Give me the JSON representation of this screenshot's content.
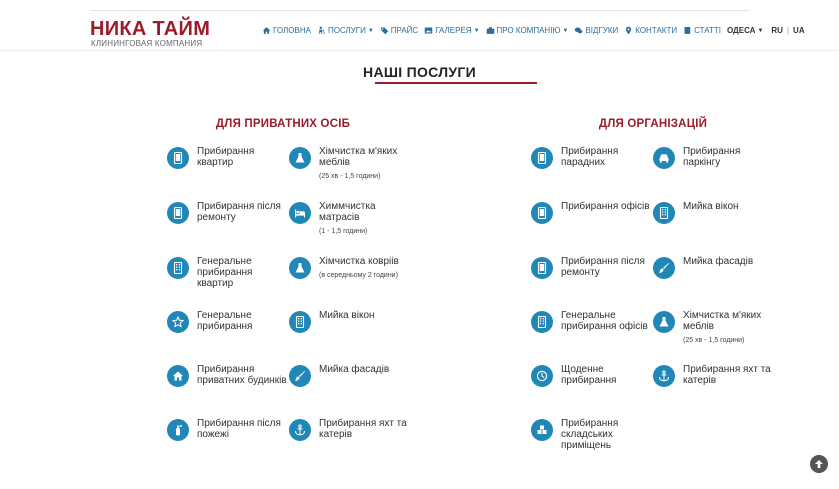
{
  "header": {
    "logo_title": "НИКА ТАЙМ",
    "logo_subtitle": "КЛИНИНГОВАЯ КОМПАНИЯ",
    "nav": [
      {
        "label": "ГОЛОВНА",
        "icon": "home-icon",
        "dropdown": false
      },
      {
        "label": "ПОСЛУГИ",
        "icon": "cleaner-icon",
        "dropdown": true
      },
      {
        "label": "ПРАЙС",
        "icon": "tags-icon",
        "dropdown": false
      },
      {
        "label": "ГАЛЕРЕЯ",
        "icon": "image-icon",
        "dropdown": true
      },
      {
        "label": "ПРО КОМПАНІЮ",
        "icon": "briefcase-icon",
        "dropdown": true
      },
      {
        "label": "ВІДГУКИ",
        "icon": "comments-icon",
        "dropdown": false
      },
      {
        "label": "КОНТАКТИ",
        "icon": "map-marker-icon",
        "dropdown": false
      },
      {
        "label": "СТАТТІ",
        "icon": "book-icon",
        "dropdown": false
      },
      {
        "label": "ОДЕСА",
        "icon": "",
        "dropdown": true
      }
    ],
    "lang_ru": "RU",
    "lang_sep": "|",
    "lang_ua": "UA"
  },
  "page_title": "НАШІ ПОСЛУГИ",
  "private": {
    "title": "ДЛЯ ПРИВАТНИХ ОСІБ",
    "left": [
      {
        "name": "Прибирання квартир",
        "note": "",
        "icon": "tablet-icon"
      },
      {
        "name": "Прибирання після ремонту",
        "note": "",
        "icon": "tablet-icon"
      },
      {
        "name": "Генеральне прибирання квартир",
        "note": "",
        "icon": "building-icon"
      },
      {
        "name": "Генеральне прибирання",
        "note": "",
        "icon": "star-icon"
      },
      {
        "name": "Прибирання приватних будинків",
        "note": "",
        "icon": "house-icon"
      },
      {
        "name": "Прибирання після пожежі",
        "note": "",
        "icon": "extinguisher-icon"
      }
    ],
    "right": [
      {
        "name": "Хімчистка м'яких меблів",
        "note": "(25 хв - 1,5 години)",
        "icon": "flask-icon"
      },
      {
        "name": "Химмчистка матрасів",
        "note": "(1 - 1,5 години)",
        "icon": "bed-icon"
      },
      {
        "name": "Хімчистка ковріів",
        "note": "(в середньому 2 години)",
        "icon": "flask-icon"
      },
      {
        "name": "Мийка вікон",
        "note": "",
        "icon": "building-icon"
      },
      {
        "name": "Мийка фасадів",
        "note": "",
        "icon": "brush-icon"
      },
      {
        "name": "Прибирання яхт та катерів",
        "note": "",
        "icon": "anchor-icon"
      }
    ]
  },
  "org": {
    "title": "ДЛЯ ОРГАНІЗАЦІЙ",
    "left": [
      {
        "name": "Прибирання парадних",
        "note": "",
        "icon": "tablet-icon"
      },
      {
        "name": "Прибирання офісів",
        "note": "",
        "icon": "tablet-icon"
      },
      {
        "name": "Прибирання після ремонту",
        "note": "",
        "icon": "tablet-icon"
      },
      {
        "name": "Генеральне прибирання офісів",
        "note": "",
        "icon": "building-icon"
      },
      {
        "name": "Щоденне прибирання",
        "note": "",
        "icon": "clock-icon"
      },
      {
        "name": "Прибирання складських приміщень",
        "note": "",
        "icon": "cubes-icon"
      }
    ],
    "right": [
      {
        "name": "Прибирання паркінгу",
        "note": "",
        "icon": "car-icon"
      },
      {
        "name": "Мийка вікон",
        "note": "",
        "icon": "building-icon"
      },
      {
        "name": "Мийка фасадів",
        "note": "",
        "icon": "brush-icon"
      },
      {
        "name": "Хімчистка м'яких меблів",
        "note": "(25 хв - 1,5 години)",
        "icon": "flask-icon"
      },
      {
        "name": "Прибирання яхт та катерів",
        "note": "",
        "icon": "anchor-icon"
      }
    ]
  },
  "colors": {
    "brand": "#9b1c2a",
    "accent": "#2187b6",
    "nav": "#2a6e9c"
  }
}
